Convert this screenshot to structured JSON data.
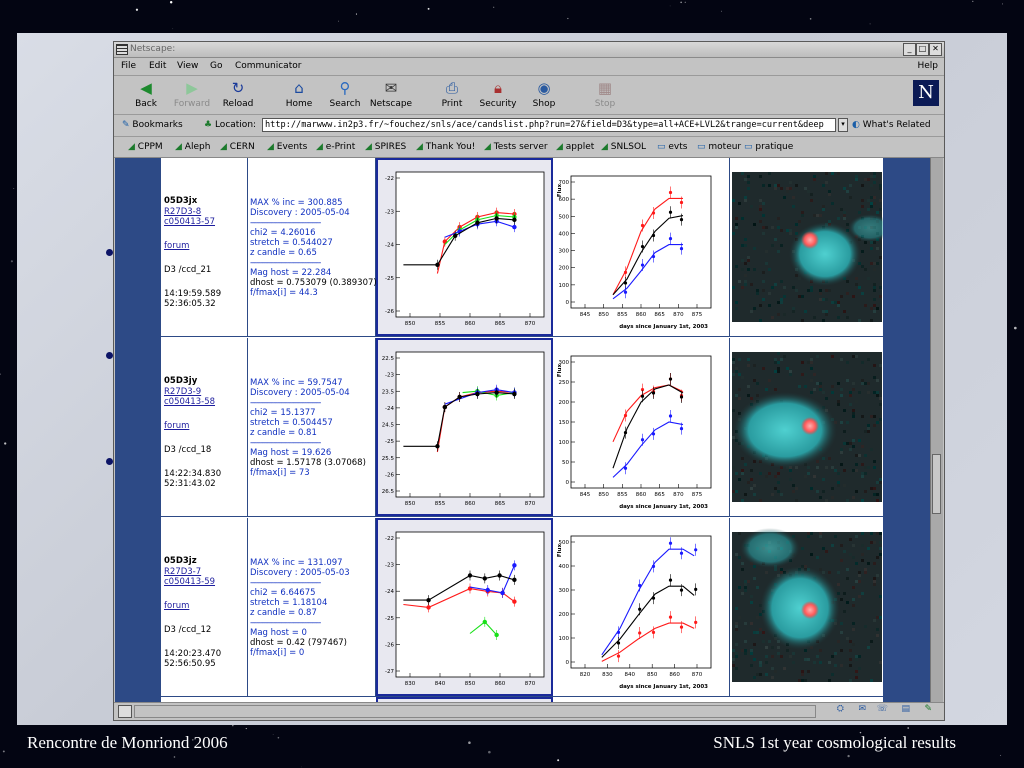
{
  "slide": {
    "footer_left": "Rencontre de Monriond 2006",
    "footer_right": "SNLS 1st year cosmological  results"
  },
  "window": {
    "title": "Netscape:",
    "menu": [
      "File",
      "Edit",
      "View",
      "Go",
      "Communicator",
      "Help"
    ],
    "toolbar": [
      {
        "label": "Back",
        "icon": "back-arrow-icon",
        "enabled": true
      },
      {
        "label": "Forward",
        "icon": "forward-arrow-icon",
        "enabled": false
      },
      {
        "label": "Reload",
        "icon": "reload-icon",
        "enabled": true
      },
      {
        "label": "Home",
        "icon": "home-icon",
        "enabled": true
      },
      {
        "label": "Search",
        "icon": "search-icon",
        "enabled": true
      },
      {
        "label": "Netscape",
        "icon": "netscape-icon",
        "enabled": true
      },
      {
        "label": "Print",
        "icon": "print-icon",
        "enabled": true
      },
      {
        "label": "Security",
        "icon": "lock-icon",
        "enabled": true
      },
      {
        "label": "Shop",
        "icon": "shop-icon",
        "enabled": true
      },
      {
        "label": "Stop",
        "icon": "stop-icon",
        "enabled": false
      }
    ],
    "location": {
      "bookmarks_label": "Bookmarks",
      "location_label": "Location:",
      "url": "http://marwww.in2p3.fr/~fouchez/snls/ace/candslist.php?run=27&field=D3&type=all+ACE+LVL2&trange=current&deep",
      "whats_related": "What's Related"
    },
    "personal_toolbar": [
      "CPPM",
      "Aleph",
      "CERN",
      "Events",
      "e-Print",
      "SPIRES",
      "Thank You!",
      "Tests server",
      "applet",
      "SNLSOL",
      "evts",
      "moteur",
      "pratique"
    ]
  },
  "candidates": [
    {
      "name": "05D3jx",
      "link1": "R27D3-8",
      "link2": "c050413-57",
      "forum": "forum",
      "ccd": "D3 /ccd_21",
      "time": "14:19:59.589",
      "coord": "52:36:05.32",
      "stats": [
        "MAX % inc = 300.885",
        "Discovery : 2005-05-04"
      ],
      "fit": [
        "chi2 = 4.26016",
        "stretch = 0.544027",
        "z candle = 0.65"
      ],
      "host": [
        "Mag host = 22.284",
        "dhost = 0.753079 (0.389307)",
        "f/fmax[i] = 44.3"
      ]
    },
    {
      "name": "05D3jy",
      "link1": "R27D3-9",
      "link2": "c050413-58",
      "forum": "forum",
      "ccd": "D3 /ccd_18",
      "time": "14:22:34.830",
      "coord": "52:31:43.02",
      "stats": [
        "MAX % inc = 59.7547",
        "Discovery : 2005-05-04"
      ],
      "fit": [
        "chi2 = 15.1377",
        "stretch = 0.504457",
        "z candle = 0.81"
      ],
      "host": [
        "Mag host = 19.626",
        "dhost = 1.57178 (3.07068)",
        "f/fmax[i] = 73"
      ]
    },
    {
      "name": "05D3jz",
      "link1": "R27D3-7",
      "link2": "c050413-59",
      "forum": "forum",
      "ccd": "D3 /ccd_12",
      "time": "14:20:23.470",
      "coord": "52:56:50.95",
      "stats": [
        "MAX % inc = 131.097",
        "Discovery : 2005-05-03"
      ],
      "fit": [
        "chi2 = 6.64675",
        "stretch = 1.18104",
        "z candle = 0.87"
      ],
      "host": [
        "Mag host = 0",
        "dhost = 0.42 (797467)",
        "f/fmax[i] = 0"
      ]
    }
  ],
  "plots": {
    "mag_ticks": [
      {
        "y": [
          "-22",
          "-23",
          "-24",
          "-25",
          "-26"
        ],
        "x": [
          "850",
          "855",
          "860",
          "865",
          "870"
        ]
      },
      {
        "y": [
          "22.5",
          "-23",
          "23.5",
          "-24",
          "24.5",
          "-25",
          "25.5",
          "-26",
          "26.5"
        ],
        "x": [
          "850",
          "855",
          "860",
          "865",
          "870"
        ]
      },
      {
        "y": [
          "-22",
          "-23",
          "-24",
          "-25",
          "-26",
          "-27"
        ],
        "x": [
          "830",
          "840",
          "850",
          "860",
          "870"
        ]
      }
    ],
    "flux_ticks": [
      {
        "y": [
          "700",
          "600",
          "500",
          "400",
          "300",
          "200",
          "100",
          "0"
        ],
        "x": [
          "845",
          "850",
          "855",
          "860",
          "865",
          "870",
          "875"
        ]
      },
      {
        "y": [
          "300",
          "250",
          "200",
          "150",
          "100",
          "50",
          "0"
        ],
        "x": [
          "845",
          "850",
          "855",
          "860",
          "865",
          "870",
          "875"
        ]
      },
      {
        "y": [
          "500",
          "400",
          "300",
          "200",
          "100",
          "0"
        ],
        "x": [
          "820",
          "830",
          "840",
          "850",
          "860",
          "870"
        ]
      }
    ],
    "flux_ylabel": "Flux",
    "flux_xlabel": "days since January 1st, 2003"
  },
  "colors": {
    "blue": "#1a1aff",
    "red": "#ff1a1a",
    "black": "#000000",
    "green": "#18e018"
  }
}
